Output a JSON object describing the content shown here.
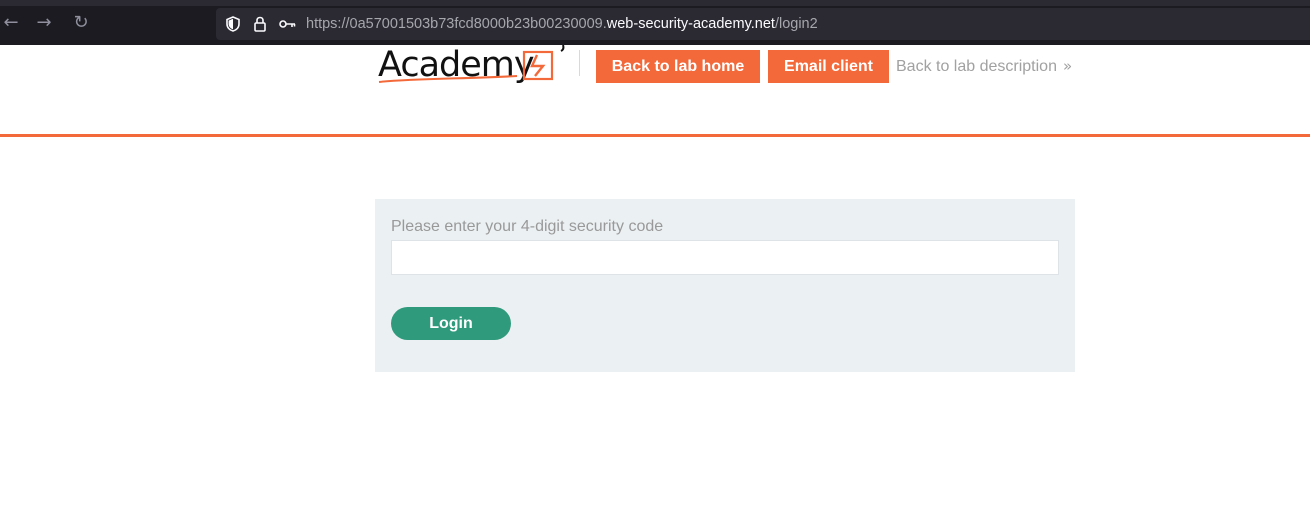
{
  "browser": {
    "url_prefix": "https://0a57001503b73fcd8000b23b00230009.",
    "url_domain": "web-security-academy.net",
    "url_path": "/login2",
    "back_glyph": "←",
    "forward_glyph": "→",
    "reload_glyph": "↻"
  },
  "header": {
    "logo_text": "Academy",
    "back_home_label": "Back to lab home",
    "email_client_label": "Email client",
    "lab_description_label": "Back to lab description",
    "chevron_glyph": "»"
  },
  "form": {
    "label": "Please enter your 4-digit security code",
    "input_value": "",
    "submit_label": "Login"
  },
  "colors": {
    "accent": "#f3693a",
    "button_green": "#2f9a7c",
    "panel_bg": "#ebf0f2"
  }
}
